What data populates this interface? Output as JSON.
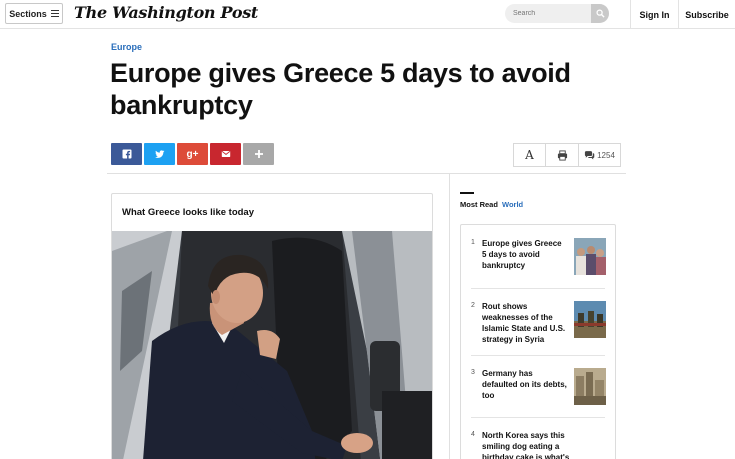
{
  "header": {
    "sections_label": "Sections",
    "logo": "The Washington Post",
    "search_placeholder": "Search",
    "signin_label": "Sign In",
    "subscribe_label": "Subscribe"
  },
  "article": {
    "kicker": "Europe",
    "headline": "Europe gives Greece 5 days to avoid bankruptcy"
  },
  "share": {
    "buttons": [
      {
        "name": "facebook",
        "icon": "facebook-icon",
        "color": "#3b5998"
      },
      {
        "name": "twitter",
        "icon": "twitter-icon",
        "color": "#1da1f2"
      },
      {
        "name": "google-plus",
        "icon": "google-plus-icon",
        "color": "#dd4b39"
      },
      {
        "name": "email",
        "icon": "email-icon",
        "color": "#c8272f"
      },
      {
        "name": "more",
        "icon": "plus-icon",
        "color": "#a8a8a8"
      }
    ],
    "tools": {
      "text_size_icon": "text-size-icon",
      "print_icon": "print-icon",
      "comments_icon": "comments-icon",
      "comment_count": "1254"
    }
  },
  "gallery": {
    "title": "What Greece looks like today"
  },
  "most_read": {
    "label": "Most Read",
    "section": "World",
    "items": [
      {
        "num": "1",
        "title": "Europe gives Greece 5 days to avoid bankruptcy"
      },
      {
        "num": "2",
        "title": "Rout shows weaknesses of the Islamic State and U.S. strategy in Syria"
      },
      {
        "num": "3",
        "title": "Germany has defaulted on its debts, too"
      },
      {
        "num": "4",
        "title": "North Korea says this smiling dog eating a birthday cake is what's"
      }
    ]
  },
  "colors": {
    "accent_link": "#2a6ebb"
  }
}
